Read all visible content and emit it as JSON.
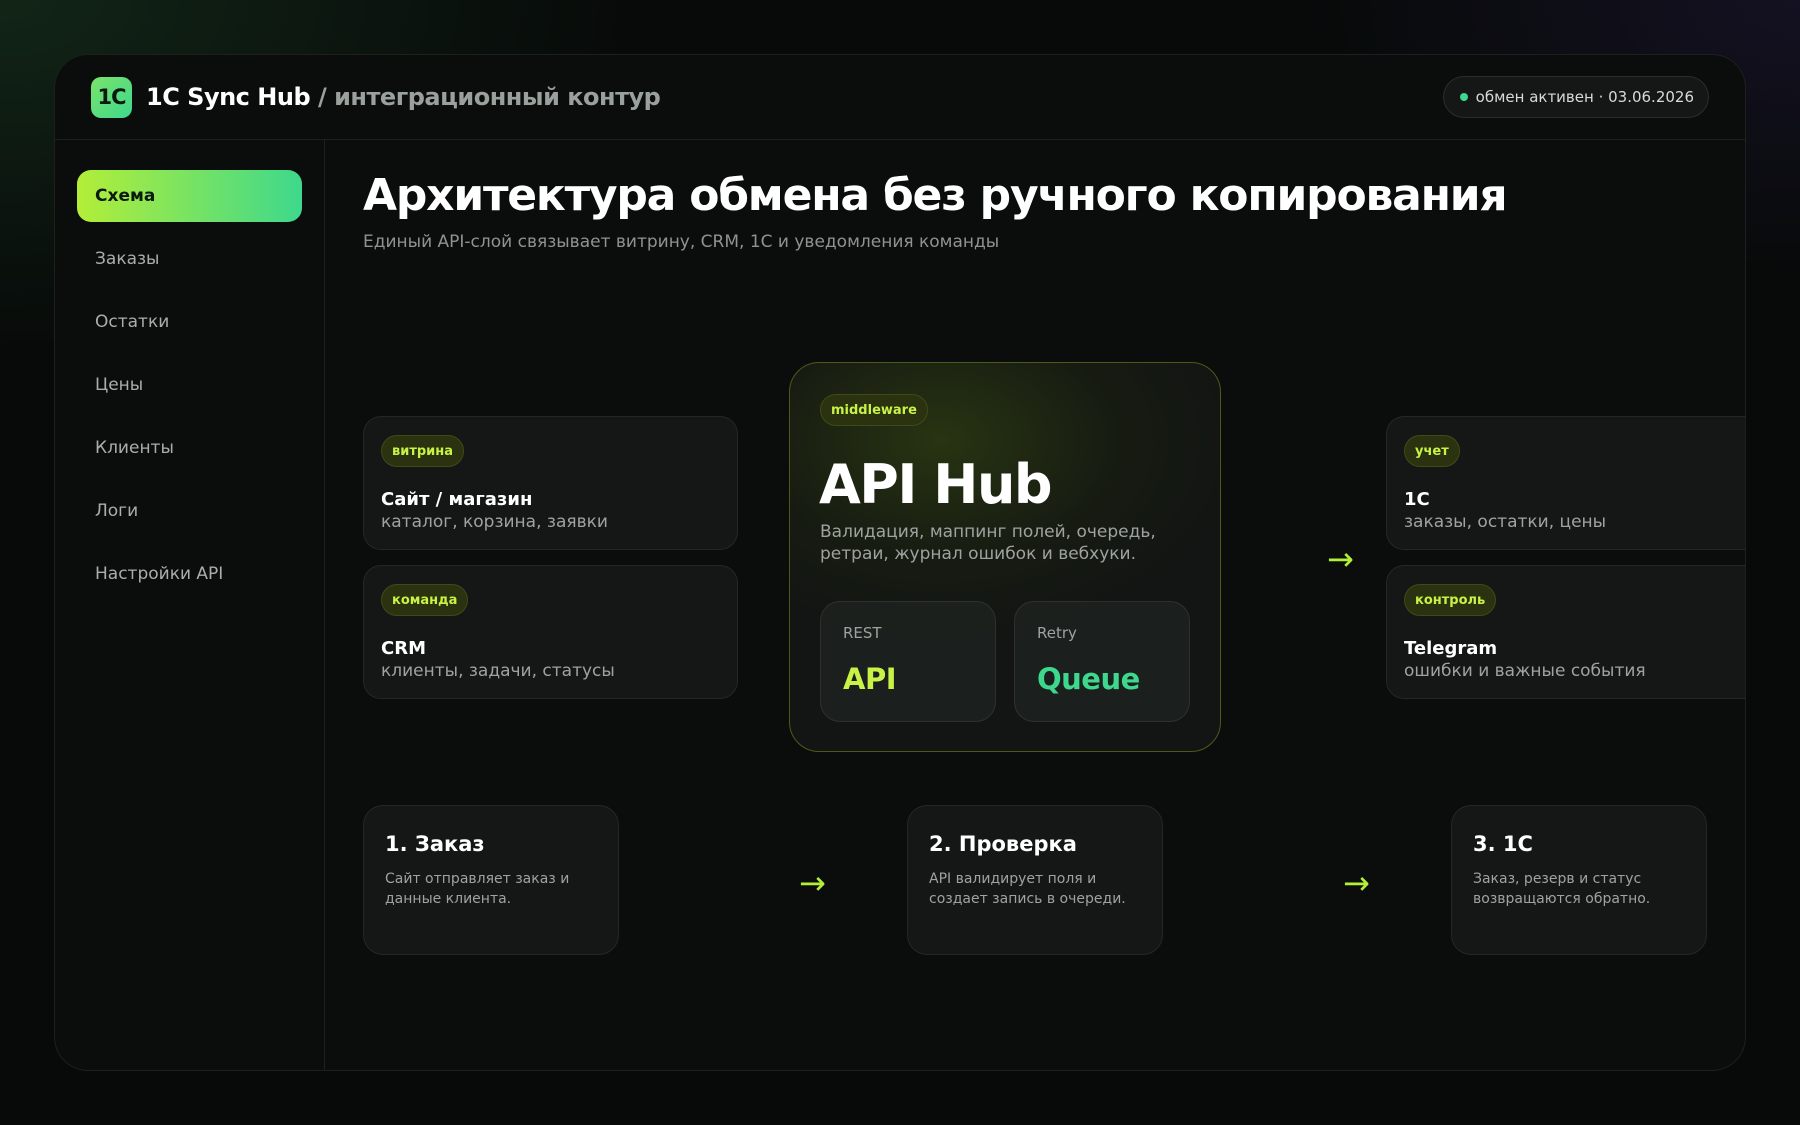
{
  "header": {
    "logo_text": "1C",
    "app_name": "1C Sync Hub",
    "separator": "/",
    "subtitle": "интеграционный контур",
    "status": "обмен активен · 03.06.2026"
  },
  "sidebar": {
    "items": [
      {
        "label": "Схема",
        "active": true
      },
      {
        "label": "Заказы"
      },
      {
        "label": "Остатки"
      },
      {
        "label": "Цены"
      },
      {
        "label": "Клиенты"
      },
      {
        "label": "Логи"
      },
      {
        "label": "Настройки API"
      }
    ]
  },
  "page": {
    "title": "Архитектура обмена без ручного копирования",
    "subtitle": "Единый API-слой связывает витрину, CRM, 1С и уведомления команды"
  },
  "sources": [
    {
      "tag": "витрина",
      "title": "Сайт / магазин",
      "desc": "каталог, корзина, заявки"
    },
    {
      "tag": "команда",
      "title": "CRM",
      "desc": "клиенты, задачи, статусы"
    }
  ],
  "hub": {
    "tag": "middleware",
    "title": "API Hub",
    "desc": "Валидация, маппинг полей, очередь, ретраи, журнал ошибок и вебхуки.",
    "modules": [
      {
        "label": "REST",
        "value": "API",
        "color": "#c8f245"
      },
      {
        "label": "Retry",
        "value": "Queue",
        "color": "#3ed88d"
      }
    ]
  },
  "targets": [
    {
      "tag": "учет",
      "title": "1С",
      "desc": "заказы, остатки, цены"
    },
    {
      "tag": "контроль",
      "title": "Telegram",
      "desc": "ошибки и важные события"
    }
  ],
  "arrow_glyph": "→",
  "steps": [
    {
      "title": "1. Заказ",
      "desc": "Сайт отправляет заказ и данные клиента."
    },
    {
      "title": "2. Проверка",
      "desc": "API валидирует поля и создает запись в очереди."
    },
    {
      "title": "3. 1С",
      "desc": "Заказ, резерв и статус возвращаются обратно."
    }
  ],
  "colors": {
    "accent_lime": "#b3ee38",
    "accent_green": "#3ed88d",
    "background": "#0b0d0d"
  }
}
